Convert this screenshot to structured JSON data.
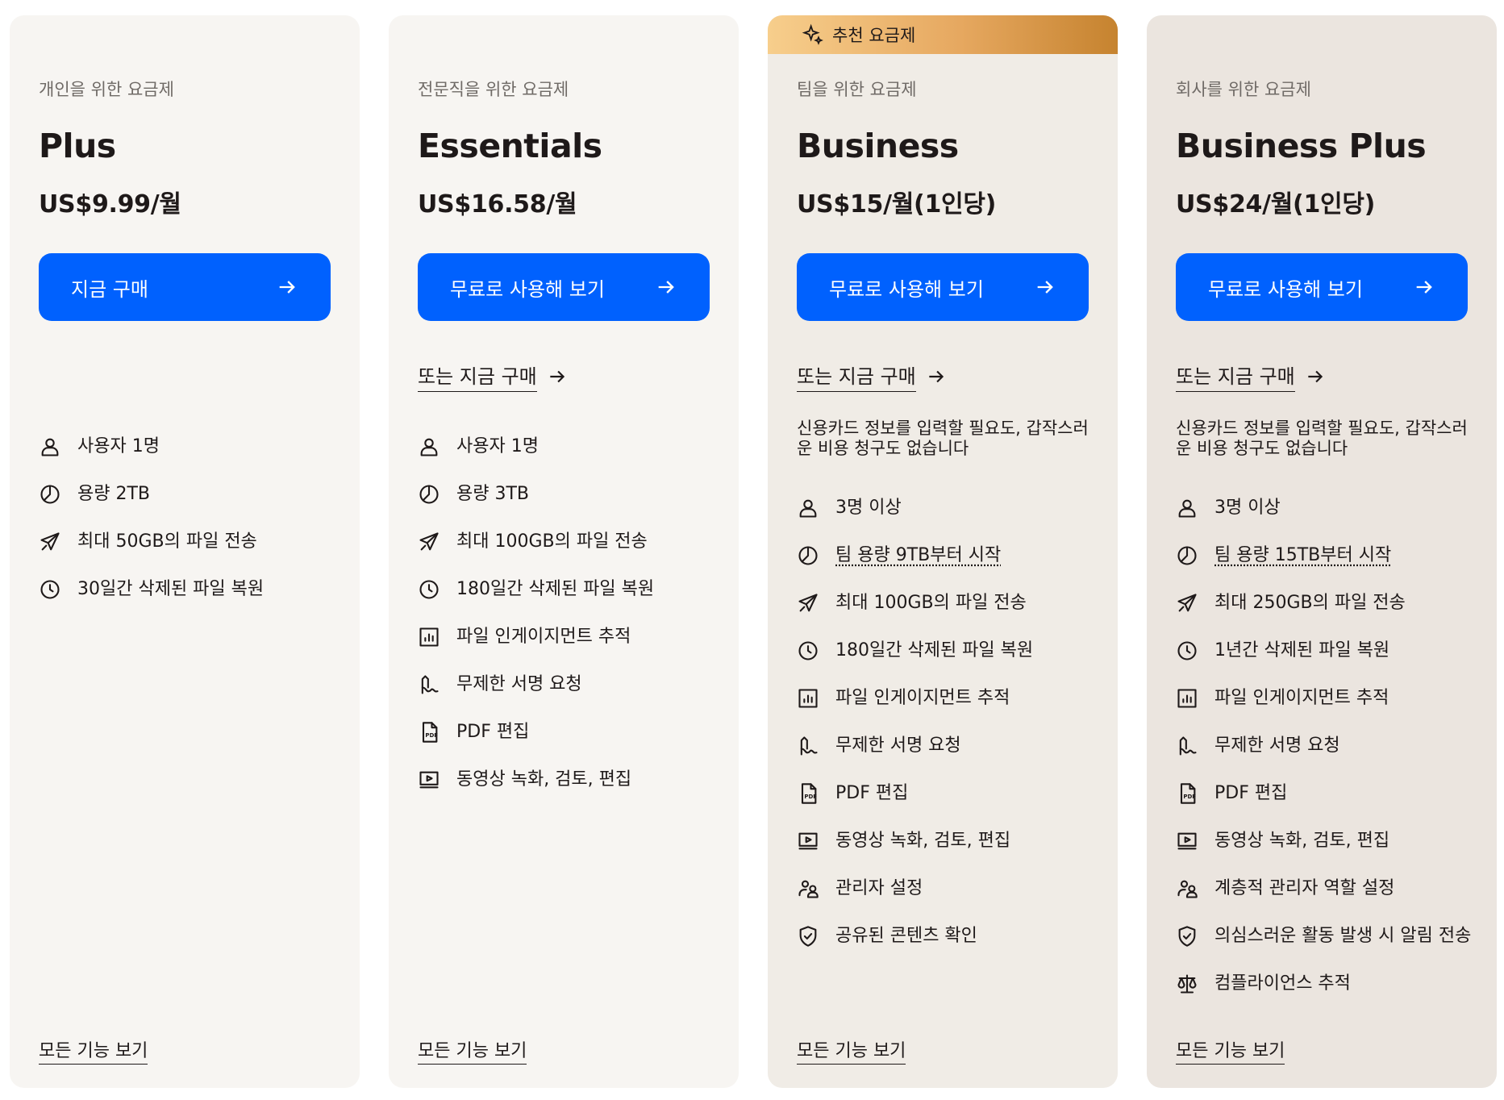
{
  "recommended_label": "추천 요금제",
  "plans": [
    {
      "tagline": "개인을 위한 요금제",
      "name": "Plus",
      "price": "US$9.99/월",
      "cta_label": "지금 구매",
      "alt_link": "",
      "note": "",
      "features": [
        {
          "icon": "user-icon",
          "text": "사용자 1명"
        },
        {
          "icon": "pie-chart-icon",
          "text": "용량 2TB"
        },
        {
          "icon": "paper-plane-icon",
          "text": "최대 50GB의 파일 전송"
        },
        {
          "icon": "clock-icon",
          "text": "30일간 삭제된 파일 복원"
        }
      ],
      "all_features_label": "모든 기능 보기"
    },
    {
      "tagline": "전문직을 위한 요금제",
      "name": "Essentials",
      "price": "US$16.58/월",
      "cta_label": "무료로 사용해 보기",
      "alt_link": "또는 지금 구매",
      "note": "",
      "features": [
        {
          "icon": "user-icon",
          "text": "사용자 1명"
        },
        {
          "icon": "pie-chart-icon",
          "text": "용량 3TB"
        },
        {
          "icon": "paper-plane-icon",
          "text": "최대 100GB의 파일 전송"
        },
        {
          "icon": "clock-icon",
          "text": "180일간 삭제된 파일 복원"
        },
        {
          "icon": "analytics-icon",
          "text": "파일 인게이지먼트 추적"
        },
        {
          "icon": "signature-icon",
          "text": "무제한 서명 요청"
        },
        {
          "icon": "pdf-icon",
          "text": "PDF 편집"
        },
        {
          "icon": "video-icon",
          "text": "동영상 녹화, 검토, 편집"
        }
      ],
      "all_features_label": "모든 기능 보기"
    },
    {
      "tagline": "팀을 위한 요금제",
      "name": "Business",
      "price": "US$15/월(1인당)",
      "cta_label": "무료로 사용해 보기",
      "alt_link": "또는 지금 구매",
      "note": "신용카드 정보를 입력할 필요도, 갑작스러운 비용 청구도 없습니다",
      "features": [
        {
          "icon": "user-icon",
          "text": "3명 이상"
        },
        {
          "icon": "pie-chart-icon",
          "text": "팀 용량 9TB부터 시작",
          "dotted": true
        },
        {
          "icon": "paper-plane-icon",
          "text": "최대 100GB의 파일 전송"
        },
        {
          "icon": "clock-icon",
          "text": "180일간 삭제된 파일 복원"
        },
        {
          "icon": "analytics-icon",
          "text": "파일 인게이지먼트 추적"
        },
        {
          "icon": "signature-icon",
          "text": "무제한 서명 요청"
        },
        {
          "icon": "pdf-icon",
          "text": "PDF 편집"
        },
        {
          "icon": "video-icon",
          "text": "동영상 녹화, 검토, 편집"
        },
        {
          "icon": "admin-users-icon",
          "text": "관리자 설정"
        },
        {
          "icon": "shield-icon",
          "text": "공유된 콘텐츠 확인"
        }
      ],
      "all_features_label": "모든 기능 보기"
    },
    {
      "tagline": "회사를 위한 요금제",
      "name": "Business Plus",
      "price": "US$24/월(1인당)",
      "cta_label": "무료로 사용해 보기",
      "alt_link": "또는 지금 구매",
      "note": "신용카드 정보를 입력할 필요도, 갑작스러운 비용 청구도 없습니다",
      "features": [
        {
          "icon": "user-icon",
          "text": "3명 이상"
        },
        {
          "icon": "pie-chart-icon",
          "text": "팀 용량 15TB부터 시작",
          "dotted": true
        },
        {
          "icon": "paper-plane-icon",
          "text": "최대 250GB의 파일 전송"
        },
        {
          "icon": "clock-icon",
          "text": "1년간 삭제된 파일 복원"
        },
        {
          "icon": "analytics-icon",
          "text": "파일 인게이지먼트 추적"
        },
        {
          "icon": "signature-icon",
          "text": "무제한 서명 요청"
        },
        {
          "icon": "pdf-icon",
          "text": "PDF 편집"
        },
        {
          "icon": "video-icon",
          "text": "동영상 녹화, 검토, 편집"
        },
        {
          "icon": "admin-users-icon",
          "text": "계층적 관리자 역할 설정"
        },
        {
          "icon": "shield-icon",
          "text": "의심스러운 활동 발생 시 알림 전송"
        },
        {
          "icon": "scale-icon",
          "text": "컴플라이언스 추적"
        }
      ],
      "all_features_label": "모든 기능 보기"
    }
  ]
}
